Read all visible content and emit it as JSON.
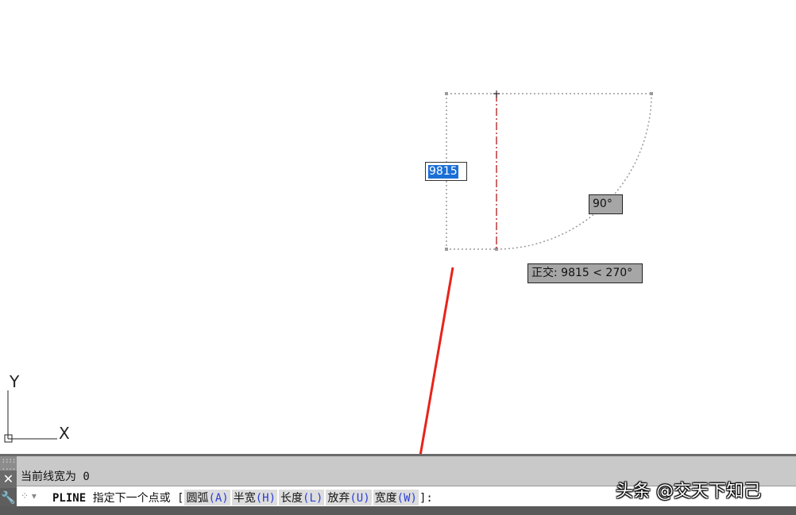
{
  "canvas": {
    "dynamic_input_value": "9815",
    "angle_tooltip": "90°",
    "ortho_tooltip": "正交: 9815 < 270°",
    "ucs_y_label": "Y",
    "ucs_x_label": "X"
  },
  "command_window": {
    "history_line": "当前线宽为 0",
    "command_name": "PLINE",
    "prompt_text": "指定下一个点或 [",
    "options": [
      {
        "label": "圆弧",
        "key": "(A)"
      },
      {
        "label": "半宽",
        "key": "(H)"
      },
      {
        "label": "长度",
        "key": "(L)"
      },
      {
        "label": "放弃",
        "key": "(U)"
      },
      {
        "label": "宽度",
        "key": "(W)"
      }
    ],
    "prompt_end": "]:"
  },
  "watermark": "头条 @交天下知己",
  "colors": {
    "arrow": "#e8231a",
    "guide_line": "#b01818",
    "dotted": "#9a9a9a",
    "selection": "#1a6fd6",
    "option_key": "#2b3fd8"
  },
  "icons": {
    "close": "close-icon",
    "customize": "wrench-icon",
    "recent_commands": "recent-commands-icon"
  }
}
